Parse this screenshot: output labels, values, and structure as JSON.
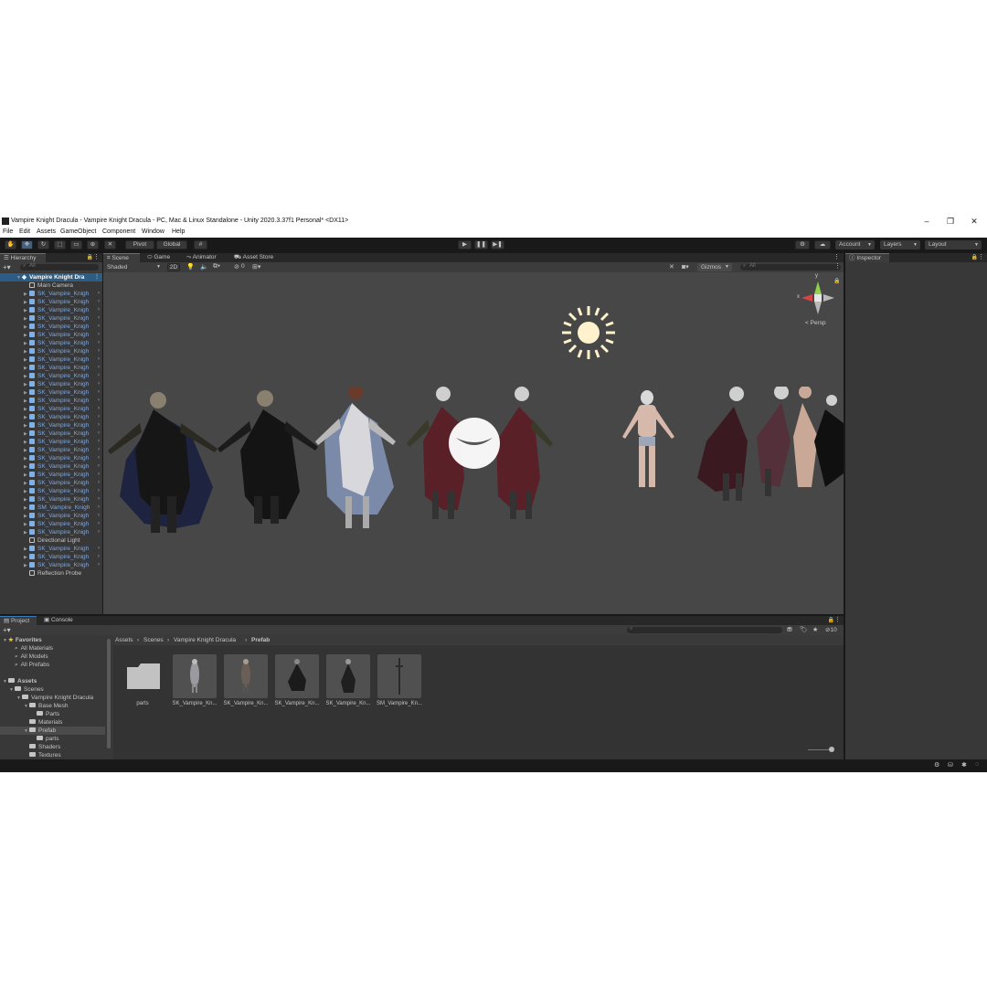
{
  "window": {
    "title": "Vampire Knight Dracula - Vampire Knight Dracula - PC, Mac & Linux Standalone - Unity 2020.3.37f1 Personal* <DX11>",
    "controls": [
      "–",
      "❐",
      "✕"
    ]
  },
  "menu": [
    "File",
    "Edit",
    "Assets",
    "GameObject",
    "Component",
    "Window",
    "Help"
  ],
  "toolbar": {
    "pivot": "Pivot",
    "global": "Global",
    "account": "Account",
    "layers": "Layers",
    "layout": "Layout"
  },
  "hierarchy": {
    "tab": "Hierarchy",
    "search_placeholder": "All",
    "scene": "Vampire Knight Dra",
    "items": [
      {
        "label": "Main Camera",
        "type": "go"
      },
      {
        "label": "SK_Vampire_Knigh",
        "type": "prefab"
      },
      {
        "label": "SK_Vampire_Knigh",
        "type": "prefab"
      },
      {
        "label": "SK_Vampire_Knigh",
        "type": "prefab"
      },
      {
        "label": "SK_Vampire_Knigh",
        "type": "prefab"
      },
      {
        "label": "SK_Vampire_Knigh",
        "type": "prefab"
      },
      {
        "label": "SK_Vampire_Knigh",
        "type": "prefab"
      },
      {
        "label": "SK_Vampire_Knigh",
        "type": "prefab"
      },
      {
        "label": "SK_Vampire_Knigh",
        "type": "prefab"
      },
      {
        "label": "SK_Vampire_Knigh",
        "type": "prefab"
      },
      {
        "label": "SK_Vampire_Knigh",
        "type": "prefab"
      },
      {
        "label": "SK_Vampire_Knigh",
        "type": "prefab"
      },
      {
        "label": "SK_Vampire_Knigh",
        "type": "prefab"
      },
      {
        "label": "SK_Vampire_Knigh",
        "type": "prefab"
      },
      {
        "label": "SK_Vampire_Knigh",
        "type": "prefab"
      },
      {
        "label": "SK_Vampire_Knigh",
        "type": "prefab"
      },
      {
        "label": "SK_Vampire_Knigh",
        "type": "prefab"
      },
      {
        "label": "SK_Vampire_Knigh",
        "type": "prefab"
      },
      {
        "label": "SK_Vampire_Knigh",
        "type": "prefab"
      },
      {
        "label": "SK_Vampire_Knigh",
        "type": "prefab"
      },
      {
        "label": "SK_Vampire_Knigh",
        "type": "prefab"
      },
      {
        "label": "SK_Vampire_Knigh",
        "type": "prefab"
      },
      {
        "label": "SK_Vampire_Knigh",
        "type": "prefab"
      },
      {
        "label": "SK_Vampire_Knigh",
        "type": "prefab"
      },
      {
        "label": "SK_Vampire_Knigh",
        "type": "prefab"
      },
      {
        "label": "SK_Vampire_Knigh",
        "type": "prefab"
      },
      {
        "label": "SK_Vampire_Knigh",
        "type": "prefab"
      },
      {
        "label": "SM_Vampire_Knigh",
        "type": "prefab"
      },
      {
        "label": "SK_Vampire_Knigh",
        "type": "prefab"
      },
      {
        "label": "SK_Vampire_Knigh",
        "type": "prefab"
      },
      {
        "label": "SK_Vampire_Knigh",
        "type": "prefab"
      },
      {
        "label": "Directional Light",
        "type": "go"
      },
      {
        "label": "SK_Vampire_Knigh",
        "type": "prefab"
      },
      {
        "label": "SK_Vampire_Knigh",
        "type": "prefab"
      },
      {
        "label": "SK_Vampire_Knigh",
        "type": "prefab"
      },
      {
        "label": "Reflection Probe",
        "type": "go"
      }
    ]
  },
  "scene": {
    "tabs": [
      "Scene",
      "Game",
      "Animator",
      "Asset Store"
    ],
    "shading": "Shaded",
    "mode_2d": "2D",
    "hidden_count": "0",
    "gizmos": "Gizmos",
    "search_placeholder": "All",
    "gizmo_axes": {
      "y": "y",
      "x": "x"
    },
    "persp": "Persp"
  },
  "inspector": {
    "tab": "Inspector"
  },
  "project": {
    "tabs": [
      "Project",
      "Console"
    ],
    "favorites_title": "Favorites",
    "favorites": [
      "All Materials",
      "All Models",
      "All Prefabs"
    ],
    "assets_title": "Assets",
    "tree": [
      "Scenes",
      "Vampire Knight Dracula",
      "Base Mesh",
      "Parts",
      "Materials",
      "Prefab",
      "parts",
      "Shaders",
      "Textures"
    ],
    "breadcrumb": [
      "Assets",
      "Scenes",
      "Vampire Knight Dracula",
      "Prefab"
    ],
    "hidden_count": "10",
    "items": [
      "parts",
      "SK_Vampire_Kn...",
      "SK_Vampire_Kn...",
      "SK_Vampire_Kn...",
      "SK_Vampire_Kn...",
      "SM_Vampire_Kn..."
    ]
  }
}
